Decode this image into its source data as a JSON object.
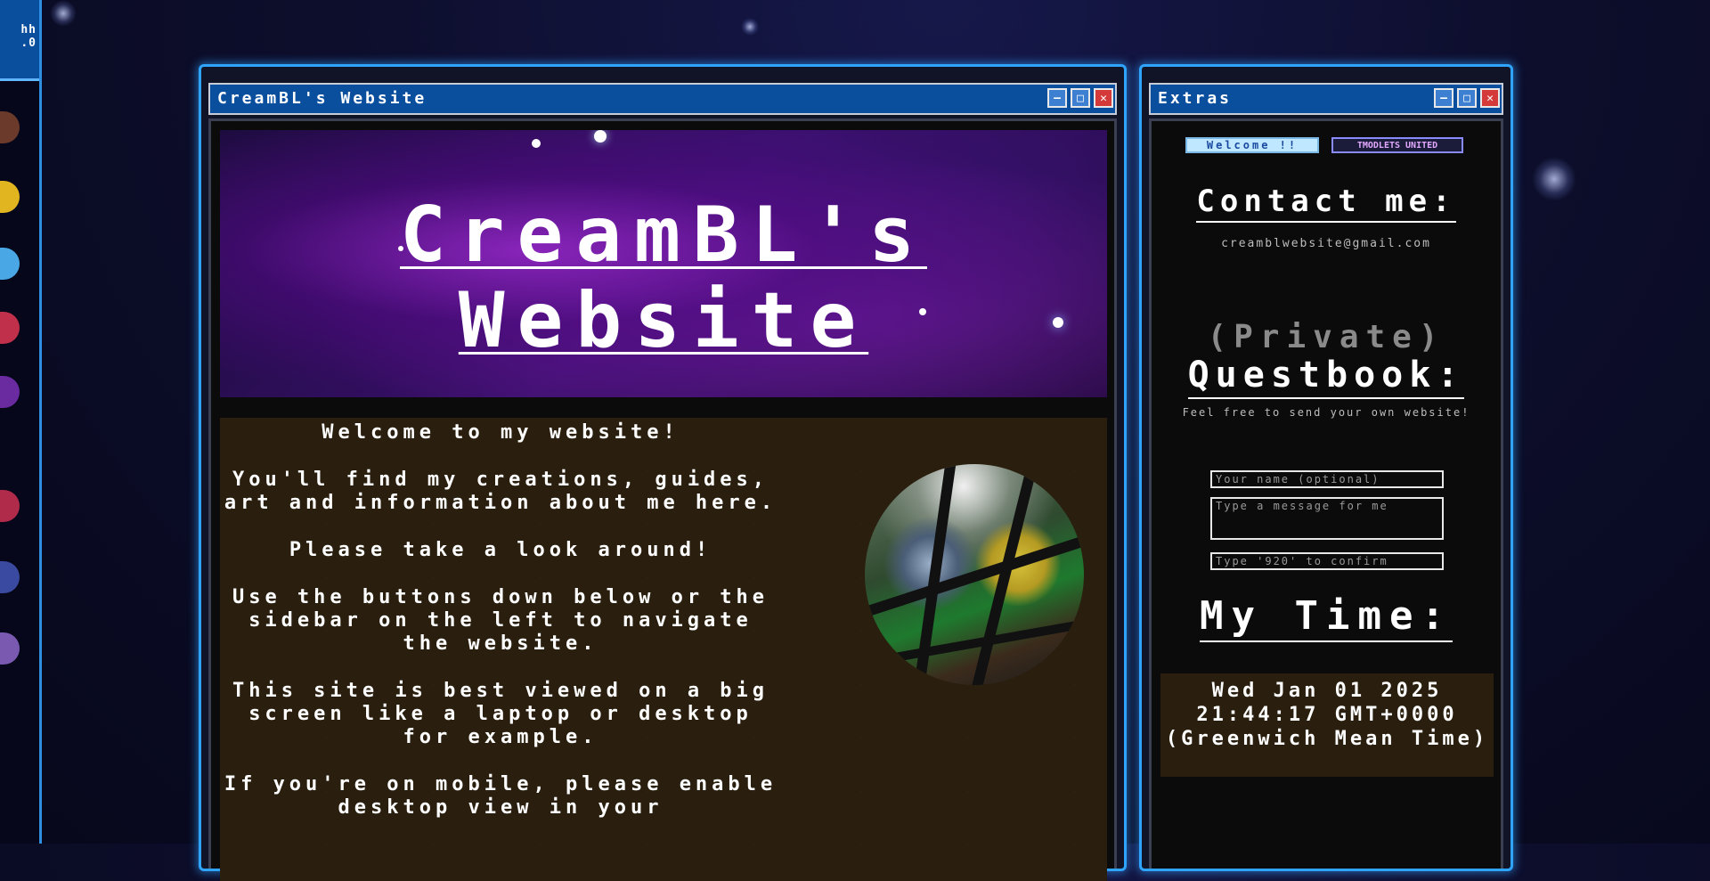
{
  "sidebar": {
    "version_label": "hh\n.0"
  },
  "main_window": {
    "title": "CreamBL's Website",
    "banner_title_line1": "CreamBL's",
    "banner_title_line2": "Website",
    "paragraphs": [
      "Welcome to my website!",
      "You'll find my creations, guides, art and information about me here.",
      "Please take a look around!",
      "Use the buttons down below or the sidebar on the left to navigate the website.",
      "This site is best viewed on a big screen like a laptop or desktop for example.",
      "If you're on mobile, please enable desktop view in your"
    ],
    "controls": {
      "minimize": "–",
      "maximize": "□",
      "close": "✕"
    }
  },
  "extras_window": {
    "title": "Extras",
    "badge_welcome": "Welcome !!",
    "badge_united": "TMODLETS UNITED",
    "contact_heading": "Contact me:",
    "email": "creamblwebsite@gmail.com",
    "private_label": "(Private)",
    "questbook_heading": "Questbook:",
    "questbook_subtext": "Feel free to send your own website!",
    "name_placeholder": "Your name (optional)",
    "message_placeholder": "Type a message for me",
    "confirm_placeholder": "Type '920' to confirm",
    "time_heading": "My Time:",
    "time_value": "Wed Jan 01 2025 21:44:17 GMT+0000 (Greenwich Mean Time)",
    "controls": {
      "minimize": "–",
      "maximize": "□",
      "close": "✕"
    }
  },
  "colors": {
    "accent": "#2fa4ff",
    "titlebar": "#0a4f9e",
    "content_bg": "#2a1f0e",
    "close": "#d43a3a"
  }
}
